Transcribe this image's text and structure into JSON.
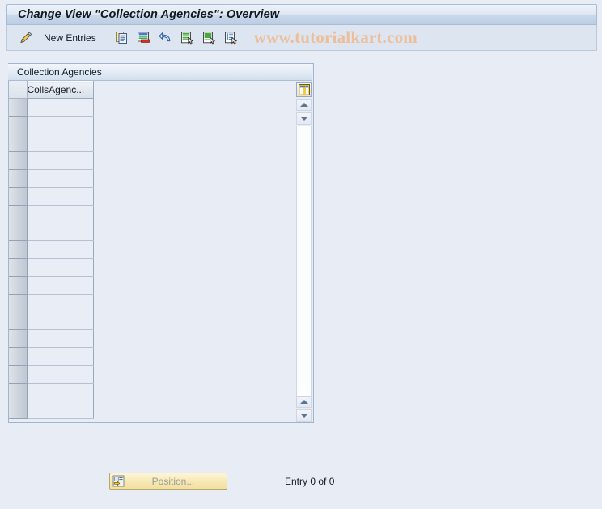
{
  "window": {
    "title": "Change View \"Collection Agencies\": Overview"
  },
  "toolbar": {
    "edit_icon_name": "pencil-icon",
    "new_entries_label": "New Entries",
    "buttons": [
      {
        "name": "copy-as-button",
        "icon": "copy-icon"
      },
      {
        "name": "delete-button",
        "icon": "delete-icon"
      },
      {
        "name": "undo-button",
        "icon": "undo-icon"
      },
      {
        "name": "select-all-button",
        "icon": "select-all-icon"
      },
      {
        "name": "deselect-all-button",
        "icon": "deselect-all-icon"
      },
      {
        "name": "details-button",
        "icon": "details-icon"
      }
    ],
    "watermark": "www.tutorialkart.com"
  },
  "group": {
    "header_label": "Collection Agencies"
  },
  "grid": {
    "columns": [
      "CollsAgenc..."
    ],
    "rows": [
      [
        ""
      ],
      [
        ""
      ],
      [
        ""
      ],
      [
        ""
      ],
      [
        ""
      ],
      [
        ""
      ],
      [
        ""
      ],
      [
        ""
      ],
      [
        ""
      ],
      [
        ""
      ],
      [
        ""
      ],
      [
        ""
      ],
      [
        ""
      ],
      [
        ""
      ],
      [
        ""
      ],
      [
        ""
      ],
      [
        ""
      ],
      [
        ""
      ]
    ],
    "column_config_icon": "table-settings-icon",
    "scroll_up_icon": "triangle-up-icon",
    "scroll_down_icon": "triangle-down-icon"
  },
  "footer": {
    "position_label": "Position...",
    "position_icon": "position-icon",
    "entry_count": "Entry 0 of 0"
  },
  "colors": {
    "background": "#e8edf5",
    "title_text": "#101820",
    "watermark": "#edbe9a",
    "grid_row": "#e9eef6",
    "button_yellow": "#f7e9b4"
  }
}
